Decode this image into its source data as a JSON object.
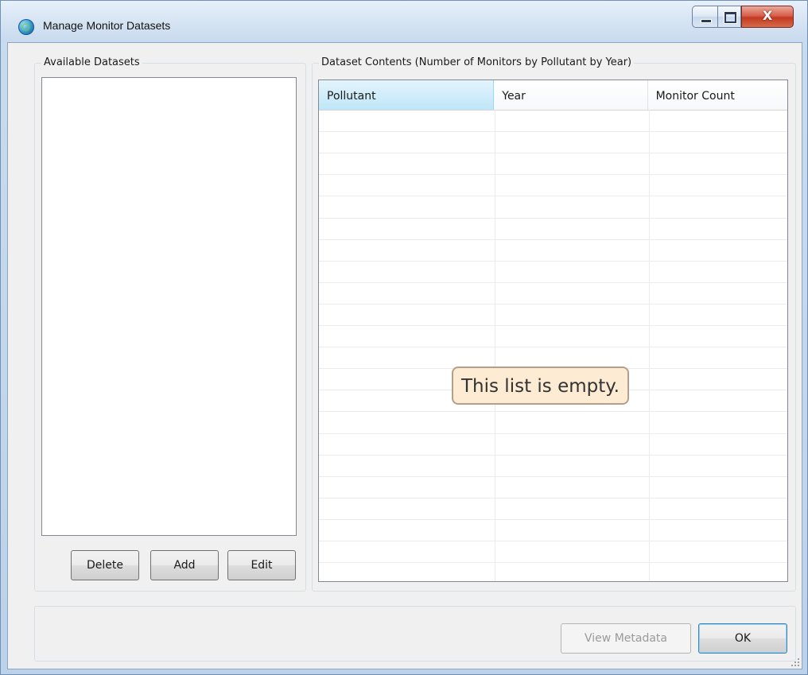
{
  "window": {
    "title": "Manage Monitor Datasets",
    "controls": {
      "minimize": "minimize",
      "maximize": "maximize",
      "close": "X"
    }
  },
  "available": {
    "legend": "Available Datasets",
    "items": [],
    "buttons": {
      "delete": "Delete",
      "add": "Add",
      "edit": "Edit"
    }
  },
  "contents": {
    "legend": "Dataset Contents (Number of Monitors by Pollutant by Year)",
    "columns": [
      "Pollutant",
      "Year",
      "Monitor Count"
    ],
    "rows": [],
    "empty_message": "This list is empty."
  },
  "footer": {
    "view_metadata": "View Metadata",
    "ok": "OK",
    "view_metadata_enabled": false
  },
  "colors": {
    "selected_header": "#bfe6f8",
    "empty_badge_bg": "#fdebd3",
    "close_button": "#c23a21"
  },
  "icons": {
    "app": "globe-icon",
    "minimize": "minimize-icon",
    "maximize": "maximize-icon",
    "close": "close-icon"
  }
}
